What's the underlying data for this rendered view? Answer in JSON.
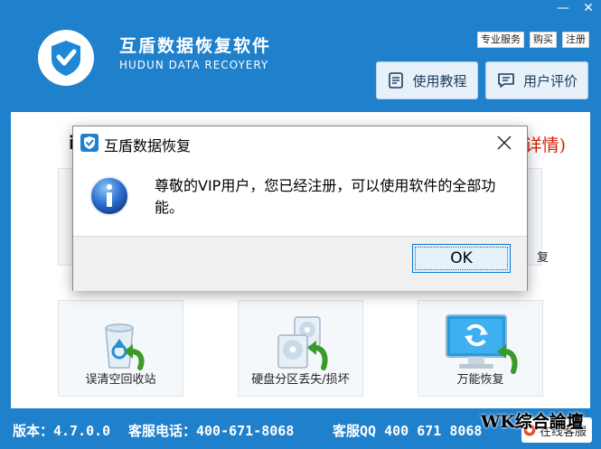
{
  "window": {
    "minimize_glyph": "—",
    "close_glyph": "✕"
  },
  "header": {
    "title": "互盾数据恢复软件",
    "subtitle": "HUDUN DATA RECOYERY",
    "links": [
      "专业服务",
      "购买",
      "注册"
    ],
    "tutorial_label": "使用教程",
    "review_label": "用户评价"
  },
  "panel": {
    "banner_left": "i",
    "banner_right": "详情)",
    "ghost_label": "复",
    "tiles": [
      {
        "label": "误清空回收站",
        "icon": "recycle-bin-icon"
      },
      {
        "label": "硬盘分区丢失/损坏",
        "icon": "disk-partition-icon"
      },
      {
        "label": "万能恢复",
        "icon": "universal-recovery-icon"
      }
    ]
  },
  "footer": {
    "version": "版本：4.7.0.0",
    "phone": "客服电话：400-671-8068",
    "qq": "客服QQ 400 671 8068",
    "online_label": "在线客服",
    "watermark": "WK综合論壇"
  },
  "dialog": {
    "title": "互盾数据恢复",
    "message": "尊敬的VIP用户，您已经注册，可以使用软件的全部功能。",
    "ok_label": "OK"
  },
  "colors": {
    "app_blue": "#1f80cc",
    "accent_red": "#d81e06",
    "button_border": "#0078d7"
  }
}
